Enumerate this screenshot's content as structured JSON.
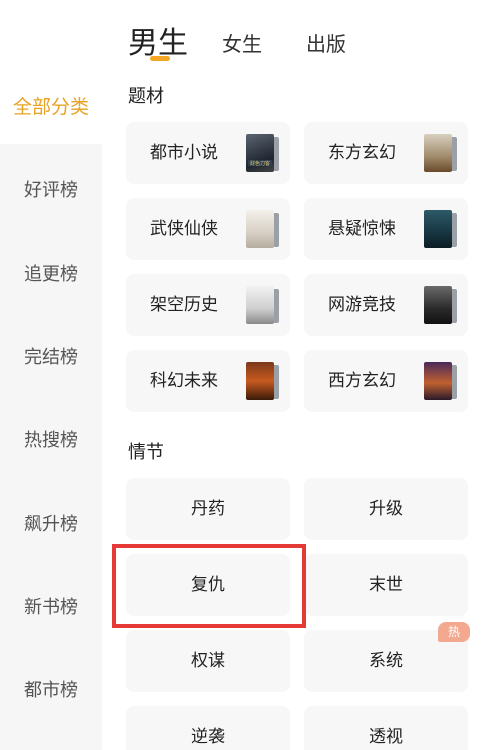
{
  "tabs": {
    "male": "男生",
    "female": "女生",
    "publish": "出版"
  },
  "sidebar": {
    "items": [
      {
        "label": "全部分类"
      },
      {
        "label": "好评榜"
      },
      {
        "label": "追更榜"
      },
      {
        "label": "完结榜"
      },
      {
        "label": "热搜榜"
      },
      {
        "label": "飙升榜"
      },
      {
        "label": "新书榜"
      },
      {
        "label": "都市榜"
      }
    ]
  },
  "sections": {
    "theme_title": "题材",
    "plot_title": "情节"
  },
  "themes": [
    {
      "label": "都市小说",
      "cover_text": "财色刀客"
    },
    {
      "label": "东方玄幻",
      "cover_text": ""
    },
    {
      "label": "武侠仙侠",
      "cover_text": ""
    },
    {
      "label": "悬疑惊悚",
      "cover_text": ""
    },
    {
      "label": "架空历史",
      "cover_text": ""
    },
    {
      "label": "网游竞技",
      "cover_text": ""
    },
    {
      "label": "科幻未来",
      "cover_text": ""
    },
    {
      "label": "西方玄幻",
      "cover_text": ""
    }
  ],
  "plots": [
    {
      "label": "丹药"
    },
    {
      "label": "升级"
    },
    {
      "label": "复仇"
    },
    {
      "label": "末世"
    },
    {
      "label": "权谋"
    },
    {
      "label": "系统",
      "badge": "热"
    },
    {
      "label": "逆袭"
    },
    {
      "label": "透视"
    }
  ],
  "colors": {
    "accent": "#f5a623",
    "active_text": "#e8a323",
    "highlight": "#e53935",
    "hot_badge": "#f3a98f"
  }
}
